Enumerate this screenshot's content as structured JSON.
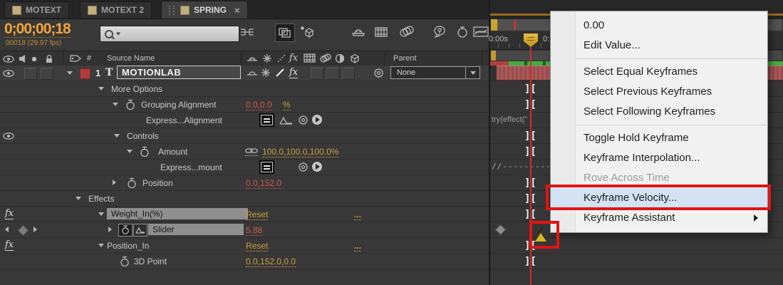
{
  "colors": {
    "accent_orange": "#f2a33c",
    "value_red": "#d25a4a",
    "value_yellow": "#c9a23a",
    "menu_highlight": "#d3e3f3",
    "annotation_red": "#e21414",
    "layer_label": "#b13c3c",
    "layer_bar": "#a85a5a",
    "playhead_red": "#c9302c",
    "render_green": "#3fae3f"
  },
  "icons": {
    "text_layer_glyph": "T",
    "fx_glyph": "fx",
    "ibeam_glyph": "][",
    "close_glyph": "×"
  },
  "tabs": {
    "items": [
      {
        "label": "MOTEXT",
        "active": false
      },
      {
        "label": "MOTEXT 2",
        "active": false
      },
      {
        "label": "SPRING",
        "active": true
      }
    ]
  },
  "transport": {
    "timecode": "0;00;00;18",
    "frame_info": "00018 (29.97 fps)"
  },
  "columns": {
    "index": "#",
    "source_name": "Source Name",
    "parent": "Parent"
  },
  "layer": {
    "number": "1",
    "name": "MOTIONLAB",
    "parent_value": "None"
  },
  "props": [
    {
      "name": "More Options"
    },
    {
      "name": "Grouping Alignment",
      "value": "0.0,0.0",
      "suffix": "%"
    },
    {
      "name": "Express...Alignment"
    },
    {
      "name": "Controls"
    },
    {
      "name": "Amount",
      "value": "100.0,100.0,100.0%"
    },
    {
      "name": "Express...mount"
    },
    {
      "name": "Position",
      "value": "0.0,152.0"
    },
    {
      "name": "Effects"
    },
    {
      "name": "Weight_In(%)",
      "value": "Reset",
      "more": "..."
    },
    {
      "name": "Slider",
      "value": "5.88"
    },
    {
      "name": "Position_In",
      "value": "Reset",
      "more": "..."
    },
    {
      "name": "3D Point",
      "value": "0.0,152.0,0.0"
    }
  ],
  "timeline": {
    "ruler_start_label": "0:00s",
    "ruler_clipped_label": "0:",
    "expression_snippet": "try{effect(\"",
    "comment_line": "//------------"
  },
  "menu": {
    "items": [
      {
        "label": "0.00"
      },
      {
        "label": "Edit Value..."
      },
      {
        "label": "Select Equal Keyframes"
      },
      {
        "label": "Select Previous Keyframes"
      },
      {
        "label": "Select Following Keyframes"
      },
      {
        "label": "Toggle Hold Keyframe"
      },
      {
        "label": "Keyframe Interpolation..."
      },
      {
        "label": "Rove Across Time"
      },
      {
        "label": "Keyframe Velocity..."
      },
      {
        "label": "Keyframe Assistant"
      }
    ]
  }
}
